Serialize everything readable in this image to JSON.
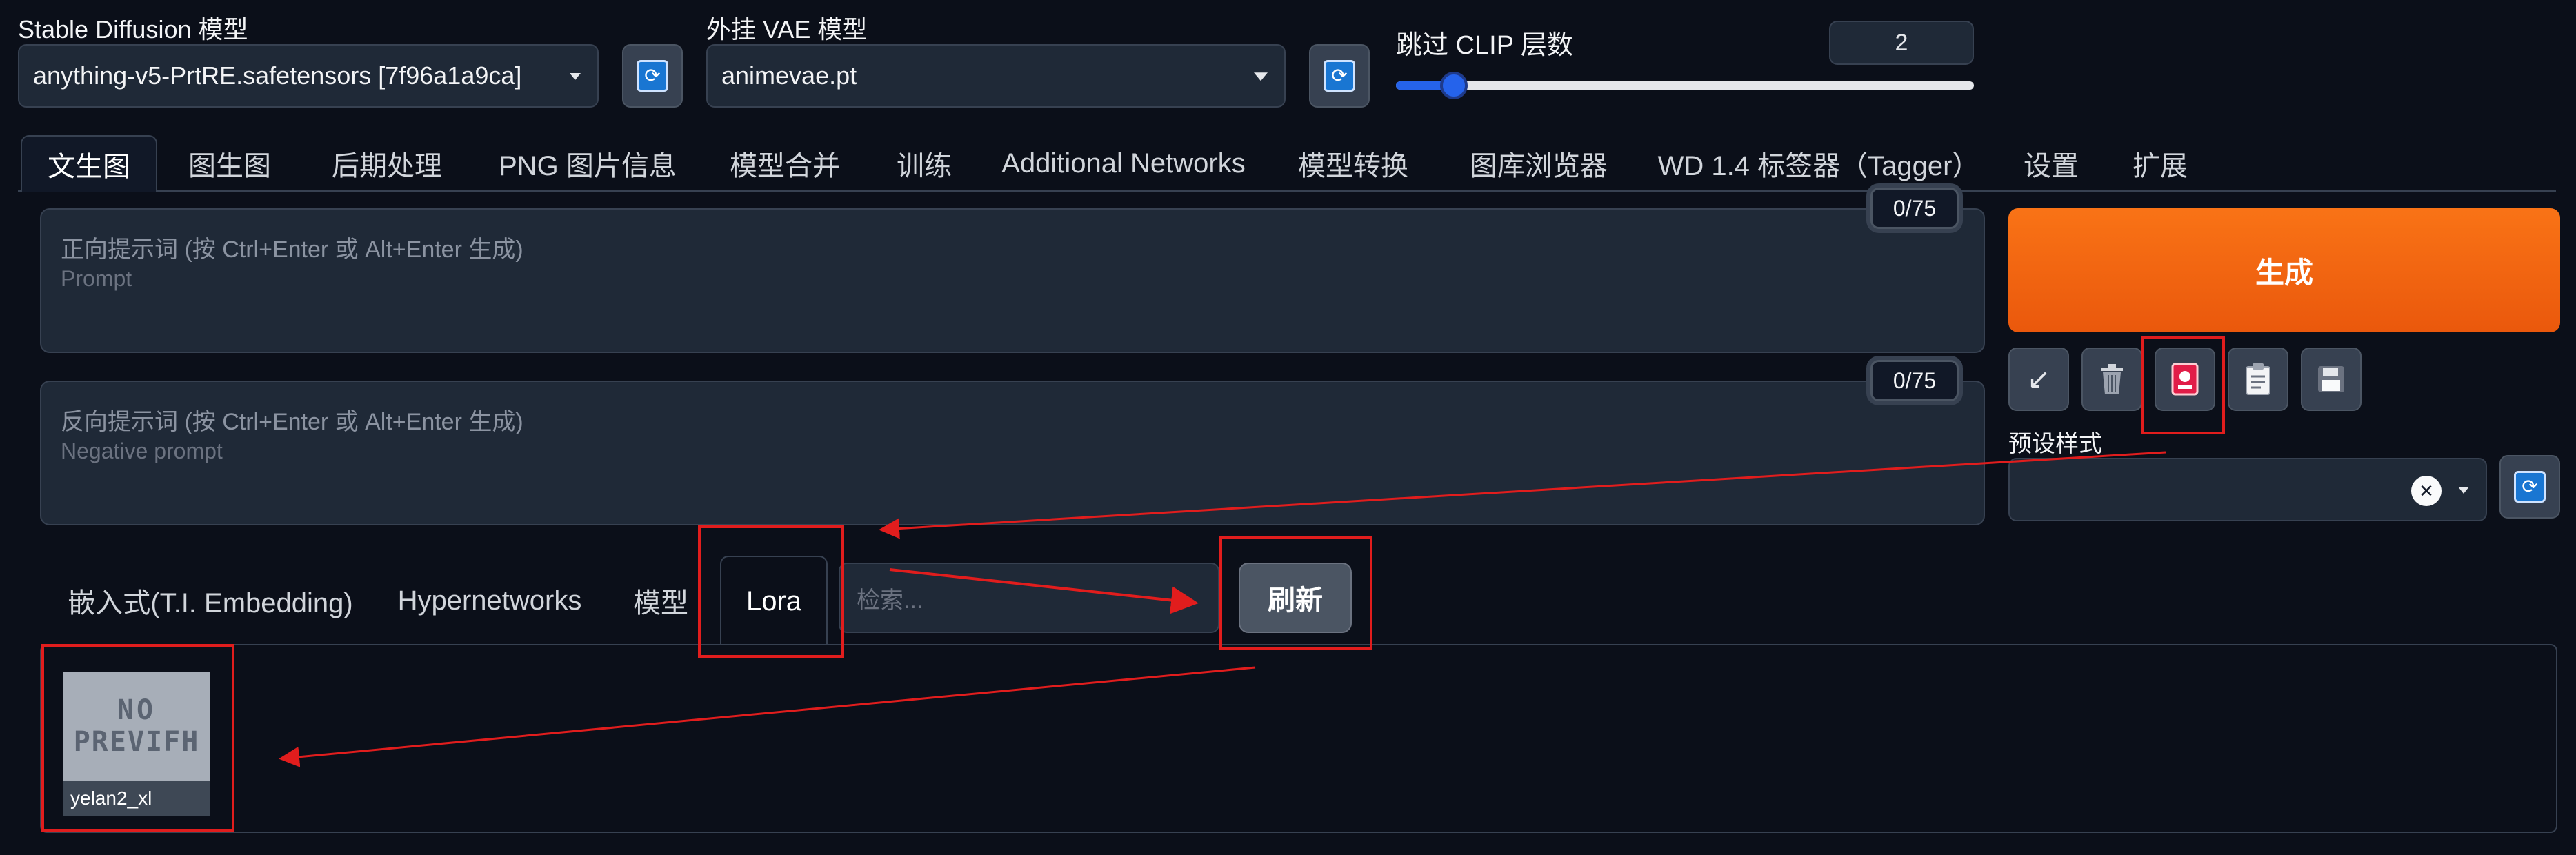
{
  "model": {
    "label": "Stable Diffusion 模型",
    "value": "anything-v5-PrtRE.safetensors [7f96a1a9ca]"
  },
  "vae": {
    "label": "外挂 VAE 模型",
    "value": "animevae.pt"
  },
  "clip": {
    "label": "跳过 CLIP 层数",
    "value": "2",
    "slider_fraction": 0.1
  },
  "tabs": [
    "文生图",
    "图生图",
    "后期处理",
    "PNG 图片信息",
    "模型合并",
    "训练",
    "Additional Networks",
    "模型转换",
    "图库浏览器",
    "WD 1.4 标签器（Tagger）",
    "设置",
    "扩展"
  ],
  "prompt": {
    "placeholder_line1": "正向提示词 (按 Ctrl+Enter 或 Alt+Enter 生成)",
    "placeholder_line2": "Prompt",
    "counter": "0/75"
  },
  "negative": {
    "placeholder_line1": "反向提示词 (按 Ctrl+Enter 或 Alt+Enter 生成)",
    "placeholder_line2": "Negative prompt",
    "counter": "0/75"
  },
  "generate_label": "生成",
  "tools": [
    "arrow-icon",
    "trash-icon",
    "card-icon",
    "clipboard-icon",
    "save-icon"
  ],
  "styles": {
    "label": "预设样式",
    "clear": "✕"
  },
  "network_tabs": [
    "嵌入式(T.I. Embedding)",
    "Hypernetworks",
    "模型",
    "Lora"
  ],
  "search": {
    "placeholder": "检索..."
  },
  "refresh_label": "刷新",
  "card": {
    "preview_text_line1": "NO",
    "preview_text_line2": "PREVIFH",
    "name": "yelan2_xl"
  },
  "colors": {
    "background": "#0b0f19",
    "generate_start": "#f97316",
    "generate_end": "#ea580c",
    "annotation": "#e11d1d"
  }
}
